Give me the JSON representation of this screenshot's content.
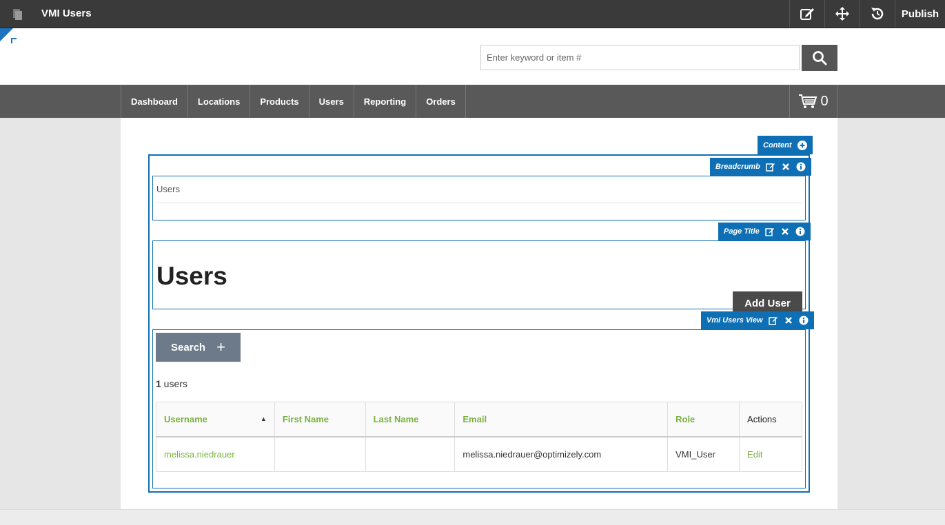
{
  "cms": {
    "title": "VMI Users",
    "publish_label": "Publish",
    "tools": [
      "edit-icon",
      "move-icon",
      "history-icon"
    ]
  },
  "header": {
    "search_placeholder": "Enter keyword or item #"
  },
  "nav": {
    "items": [
      "Dashboard",
      "Locations",
      "Products",
      "Users",
      "Reporting",
      "Orders"
    ],
    "cart_count": "0"
  },
  "zones": {
    "content_label": "Content",
    "breadcrumb_label": "Breadcrumb",
    "page_title_label": "Page Title",
    "users_view_label": "Vmi Users View"
  },
  "breadcrumb": {
    "current": "Users"
  },
  "page": {
    "title": "Users",
    "add_user_label": "Add User"
  },
  "users_view": {
    "search_label": "Search",
    "search_toggle_glyph": "+",
    "count_number": "1",
    "count_suffix": " users",
    "columns": [
      "Username",
      "First Name",
      "Last Name",
      "Email",
      "Role",
      "Actions"
    ],
    "rows": [
      {
        "username": "melissa.niedrauer",
        "first_name": "",
        "last_name": "",
        "email": "melissa.niedrauer@optimizely.com",
        "role": "VMI_User",
        "action": "Edit"
      }
    ]
  },
  "colors": {
    "cms_bar": "#3a3a3a",
    "nav_bar": "#595959",
    "editor_blue": "#0f6fb4",
    "link_green": "#78b13f",
    "search_button": "#6d7a8a"
  }
}
